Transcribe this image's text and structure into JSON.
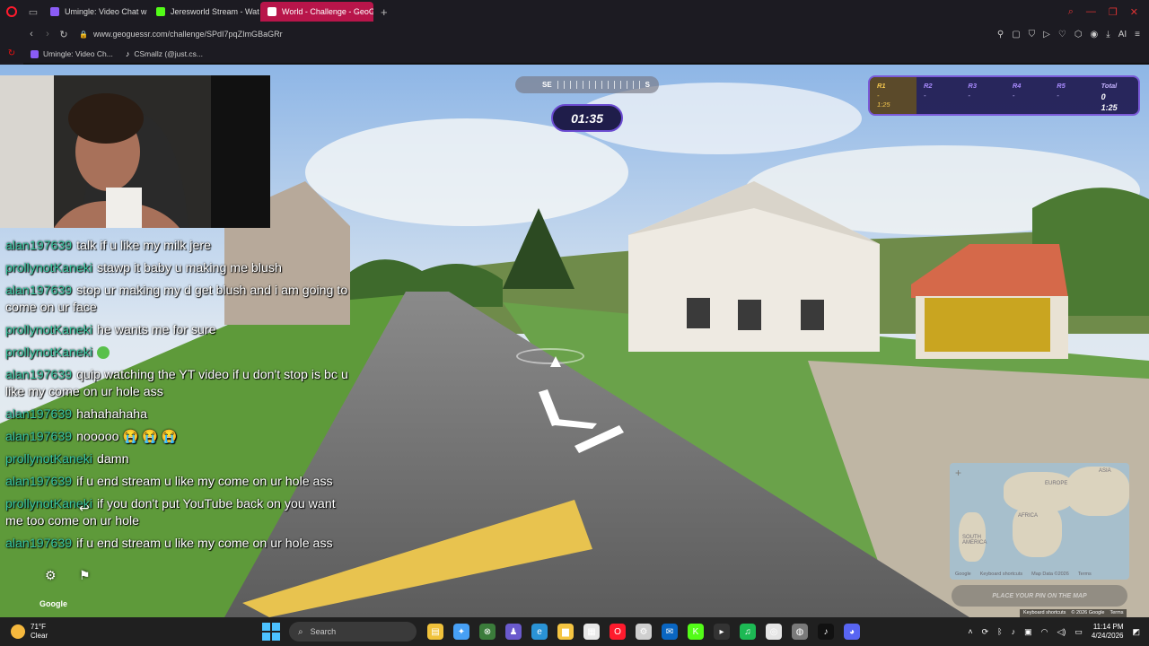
{
  "browser": {
    "tabs": [
      {
        "label": "Umingle: Video Chat w",
        "color": "#8b5cf6",
        "active": false
      },
      {
        "label": "Jeresworld Stream - Wat",
        "color": "#53fc18",
        "active": false
      },
      {
        "label": "World - Challenge - GeoG",
        "color": "#ff3d6e",
        "active": true
      }
    ],
    "url": "www.geoguessr.com/challenge/SPdI7pqZImGBaGRr",
    "bookmarks": [
      "Umingle: Video Ch...",
      "CSmallz (@just.cs..."
    ]
  },
  "game": {
    "compass": {
      "left": "SE",
      "right": "S"
    },
    "timer": "01:35",
    "rounds": [
      {
        "label": "R1",
        "value": "-",
        "time": "1:25"
      },
      {
        "label": "R2",
        "value": "-"
      },
      {
        "label": "R3",
        "value": "-"
      },
      {
        "label": "R4",
        "value": "-"
      },
      {
        "label": "R5",
        "value": "-"
      }
    ],
    "total": {
      "label": "Total",
      "score": "0",
      "time": "1:25"
    },
    "minimap": {
      "labels": {
        "asia": "ASIA",
        "europe": "EUROPE",
        "africa": "AFRICA",
        "south_america": "SOUTH AMERICA"
      },
      "footer": [
        "Google",
        "Keyboard shortcuts",
        "Map Data ©2026",
        "Terms"
      ]
    },
    "guess_button": "PLACE YOUR PIN ON THE MAP",
    "attribution": [
      "Keyboard shortcuts",
      "© 2026 Google",
      "Terms"
    ],
    "google_logo": "Google"
  },
  "chat": [
    {
      "user": "alan197639",
      "text": "talk if u like my milk jere"
    },
    {
      "user": "prollynotKaneki",
      "text": "stawp it baby u making me blush"
    },
    {
      "user": "alan197639",
      "text": "stop ur making my d get blush and i am going to come on ur face"
    },
    {
      "user": "prollynotKaneki",
      "text": "he wants me for sure"
    },
    {
      "user": "prollynotKaneki",
      "text": "",
      "emote": "#59c04b"
    },
    {
      "user": "alan197639",
      "text": "quip watching the YT video if u don't stop is bc u like my come on ur hole ass"
    },
    {
      "user": "alan197639",
      "text": "hahahahaha"
    },
    {
      "user": "alan197639",
      "text": "nooooo 😭 😭 😭"
    },
    {
      "user": "prollynotKaneki",
      "text": "damn"
    },
    {
      "user": "alan197639",
      "text": "if u end stream u like my come on ur hole ass"
    },
    {
      "user": "prollynotKaneki",
      "text": "if you don't put YouTube back on you want me too come on ur hole"
    },
    {
      "user": "alan197639",
      "text": "if u end stream u like my come on ur hole ass"
    }
  ],
  "taskbar": {
    "weather": {
      "temp": "71°F",
      "cond": "Clear"
    },
    "search_placeholder": "Search",
    "time": "11:14 PM",
    "date": "4/24/2026"
  },
  "icons": [
    "search-icon",
    "file-explorer-icon",
    "copilot-icon",
    "xbox-icon",
    "teams-icon",
    "edge-icon",
    "folder-icon",
    "store-icon",
    "opera-icon",
    "settings-icon",
    "mail-icon",
    "kick-icon",
    "terminal-icon",
    "spotify-icon",
    "chrome-icon",
    "obs-icon",
    "tiktok-icon",
    "discord-icon"
  ]
}
